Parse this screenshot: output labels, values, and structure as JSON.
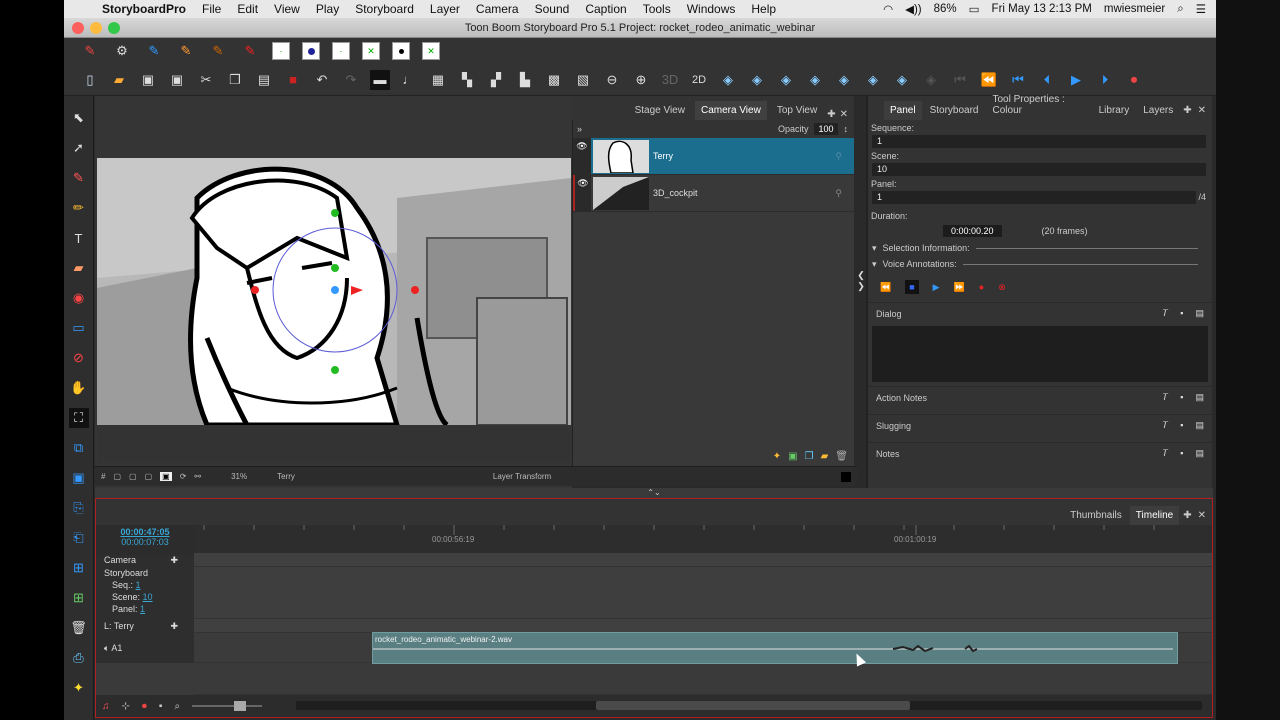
{
  "menubar": {
    "app": "StoryboardPro",
    "items": [
      "File",
      "Edit",
      "View",
      "Play",
      "Storyboard",
      "Layer",
      "Camera",
      "Sound",
      "Caption",
      "Tools",
      "Windows",
      "Help"
    ],
    "battery": "86%",
    "datetime": "Fri May 13  2:13 PM",
    "user": "mwiesmeier"
  },
  "window": {
    "title": "Toon Boom Storyboard Pro 5.1 Project: rocket_rodeo_animatic_webinar"
  },
  "view_tabs": [
    "Stage View",
    "Camera View",
    "Top View"
  ],
  "layers": {
    "opacity_label": "Opacity",
    "opacity_value": "100",
    "items": [
      {
        "name": "Terry"
      },
      {
        "name": "3D_cockpit"
      }
    ]
  },
  "stage_status": {
    "zoom": "31%",
    "layer": "Terry",
    "mode": "Layer Transform"
  },
  "panel": {
    "tabs": [
      "Panel",
      "Storyboard",
      "Tool Properties : Colour",
      "Library",
      "Layers"
    ],
    "sequence_label": "Sequence:",
    "sequence_value": "1",
    "scene_label": "Scene:",
    "scene_value": "10",
    "panel_label": "Panel:",
    "panel_value": "1",
    "panel_total": "/4",
    "duration_label": "Duration:",
    "duration_value": "0:00:00.20",
    "duration_frames": "(20 frames)",
    "selection_info": "Selection Information:",
    "voice_annotations": "Voice Annotations:",
    "sections": [
      "Dialog",
      "Action Notes",
      "Slugging",
      "Notes"
    ]
  },
  "timeline": {
    "tabs": [
      "Thumbnails",
      "Timeline"
    ],
    "timecode": "00:00:47:05",
    "subcode": "00:00:07:03",
    "ruler_marks": [
      "00:00:56:19",
      "00:01:00:19"
    ],
    "tracks": {
      "camera": "Camera",
      "storyboard": "Storyboard",
      "seq_label": "Seq.:",
      "seq_value": "1",
      "scene_label": "Scene:",
      "scene_value": "10",
      "panel_label": "Panel:",
      "panel_value": "1",
      "layer": "L: Terry",
      "audio": "A1"
    },
    "audio_clip": "rocket_rodeo_animatic_webinar-2.wav"
  },
  "colors": {
    "accent": "#1c6e8e",
    "timecode": "#39a7d6",
    "audio_clip": "#5a7f82"
  }
}
